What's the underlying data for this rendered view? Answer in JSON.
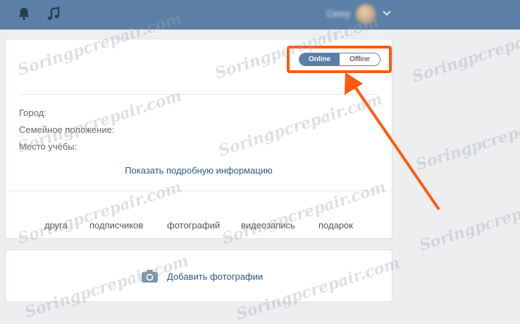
{
  "topbar": {
    "icons": [
      "bell-icon",
      "music-note-icon",
      "chevron-down-icon"
    ],
    "user_name": "Сemy"
  },
  "status_toggle": {
    "online_label": "Online",
    "offline_label": "Offline",
    "selected": "Online"
  },
  "profile_info": {
    "city_label": "Город:",
    "marital_label": "Семейное положение:",
    "education_label": "Место учёбы:",
    "show_more": "Показать подробную информацию"
  },
  "counters": [
    {
      "label": "друга"
    },
    {
      "label": "подписчиков"
    },
    {
      "label": "фотографий"
    },
    {
      "label": "видеозапись"
    },
    {
      "label": "подарок"
    }
  ],
  "photos": {
    "add_label": "Добавить фотографии",
    "icon": "camera-icon"
  },
  "annotation": {
    "highlight_color": "#ff5a10"
  },
  "watermark": "Soringpcrepair.com",
  "colors": {
    "header": "#5b7fa6",
    "link": "#2a5885",
    "background": "#edeef0"
  }
}
